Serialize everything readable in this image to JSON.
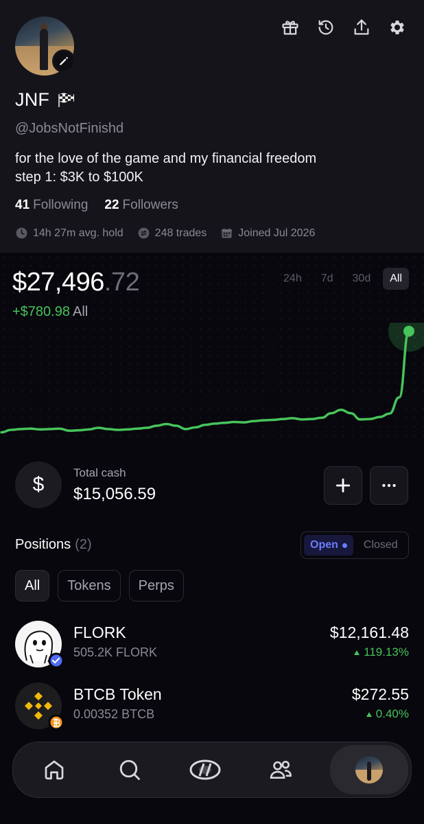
{
  "profile": {
    "name": "JNF",
    "flag_icon": "checkered-flag-icon",
    "handle": "@JobsNotFinishd",
    "bio_line1": "for the love of the game and my financial freedom",
    "bio_line2": "step 1: $3K to $100K",
    "following_count": "41",
    "following_label": "Following",
    "followers_count": "22",
    "followers_label": "Followers",
    "avg_hold": "14h 27m avg. hold",
    "trades": "248 trades",
    "joined": "Joined Jul 2026"
  },
  "header_icons": [
    "gift-icon",
    "history-icon",
    "share-icon",
    "settings-icon"
  ],
  "portfolio": {
    "balance_main": "$27,496",
    "balance_cents": ".72",
    "pnl_value": "+$780.98",
    "pnl_period": "All",
    "ranges": [
      "24h",
      "7d",
      "30d",
      "All"
    ],
    "active_range": "All"
  },
  "chart_data": {
    "type": "line",
    "title": "",
    "xlabel": "",
    "ylabel": "",
    "y": [
      25070,
      25130,
      25150,
      25160,
      25140,
      25150,
      25160,
      25110,
      25120,
      25140,
      25180,
      25150,
      25130,
      25140,
      25160,
      25180,
      25230,
      25270,
      25230,
      25150,
      25190,
      25250,
      25280,
      25300,
      25320,
      25310,
      25340,
      25360,
      25370,
      25390,
      25410,
      25380,
      25390,
      25420,
      25530,
      25610,
      25530,
      25380,
      25390,
      25440,
      25520,
      25910,
      27496.72
    ],
    "ylim": [
      24900,
      27700
    ],
    "line_color": "#47c45a"
  },
  "cash": {
    "label": "Total cash",
    "value": "$15,056.59",
    "currency_symbol": "$"
  },
  "positions": {
    "title": "Positions",
    "count": "(2)",
    "toggle_open": "Open",
    "toggle_closed": "Closed",
    "filters": [
      "All",
      "Tokens",
      "Perps"
    ],
    "items": [
      {
        "name": "FLORK",
        "amount": "505.2K FLORK",
        "value": "$12,161.48",
        "change": "119.13%"
      },
      {
        "name": "BTCB Token",
        "amount": "0.00352 BTCB",
        "value": "$272.55",
        "change": "0.40%"
      }
    ]
  },
  "nav": {
    "items": [
      "home-icon",
      "search-icon",
      "trade-icon",
      "social-icon",
      "profile-avatar"
    ]
  },
  "colors": {
    "accent_green": "#47c45a",
    "accent_blue": "#6c7cff",
    "background": "#07070d",
    "header_bg": "#15141b"
  }
}
